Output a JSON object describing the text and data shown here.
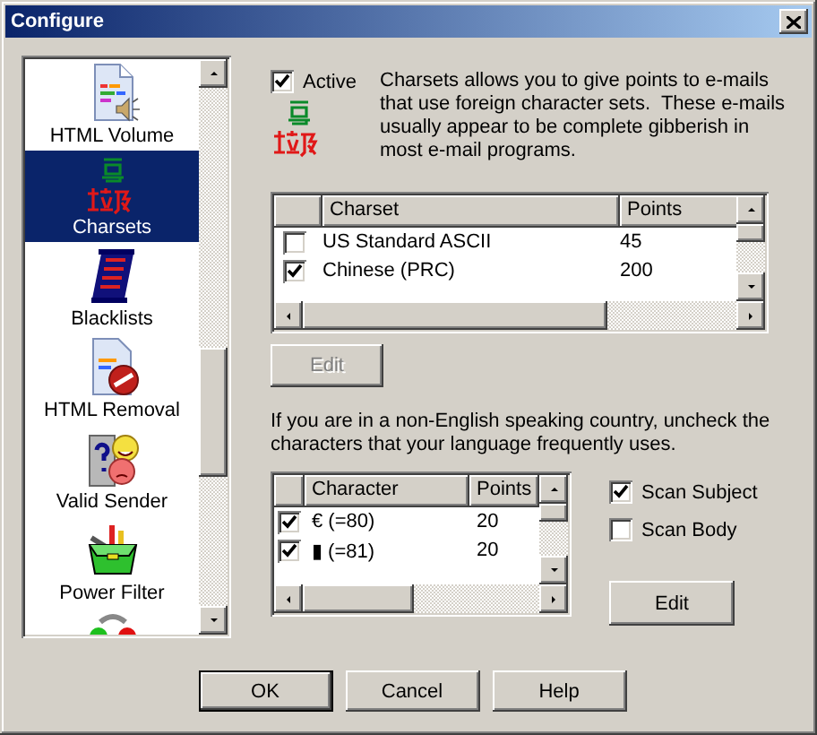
{
  "window": {
    "title": "Configure"
  },
  "sidebar": {
    "items": [
      {
        "label": "HTML Volume",
        "kind": "document",
        "selected": false
      },
      {
        "label": "Charsets",
        "kind": "charset",
        "selected": true
      },
      {
        "label": "Blacklists",
        "kind": "scroll",
        "selected": false
      },
      {
        "label": "HTML Removal",
        "kind": "blocked-document",
        "selected": false
      },
      {
        "label": "Valid Sender",
        "kind": "faces",
        "selected": false
      },
      {
        "label": "Power Filter",
        "kind": "toolbox",
        "selected": false
      },
      {
        "kind": "dots",
        "selected": false
      }
    ]
  },
  "filter": {
    "active": {
      "label": "Active",
      "checked": true
    },
    "description": "Charsets allows you to give points to e-mails that use foreign character sets.  These e-mails usually appear to be complete gibberish in most e-mail programs.",
    "charsets": {
      "columns": [
        "Charset",
        "Points"
      ],
      "rows": [
        {
          "name": "US Standard ASCII",
          "points": "45",
          "checked": false
        },
        {
          "name": "Chinese (PRC)",
          "points": "200",
          "checked": true
        }
      ]
    },
    "charset_edit": {
      "label": "Edit",
      "disabled": true
    },
    "hint": "If you are in a non-English speaking country, uncheck the characters that your language frequently uses.",
    "characters": {
      "columns": [
        "Character",
        "Points"
      ],
      "rows": [
        {
          "name": "€ (=80)",
          "points": "20",
          "checked": true
        },
        {
          "name": "▮ (=81)",
          "points": "20",
          "checked": true
        }
      ]
    },
    "scan_subject": {
      "label": "Scan Subject",
      "checked": true
    },
    "scan_body": {
      "label": "Scan Body",
      "checked": false
    },
    "character_edit": {
      "label": "Edit",
      "disabled": false
    }
  },
  "buttons": [
    {
      "label": "OK",
      "default": true
    },
    {
      "label": "Cancel",
      "default": false
    },
    {
      "label": "Help",
      "default": false
    }
  ]
}
